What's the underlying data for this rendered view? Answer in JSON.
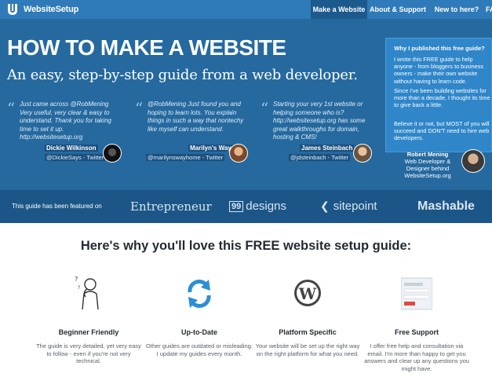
{
  "header": {
    "logo_text": "WebsiteSetup",
    "nav": [
      {
        "label": "Make a Website",
        "active": true
      },
      {
        "label": "About & Support",
        "active": false
      },
      {
        "label": "New to here?",
        "active": false
      },
      {
        "label": "FA",
        "active": false
      }
    ]
  },
  "hero": {
    "title": "HOW TO MAKE A WEBSITE",
    "subtitle": "An easy, step-by-step guide from a web developer.",
    "testimonials": [
      {
        "text": "Just came across @RobMening Very useful, very clear & easy to understand. Thank you for taking time to set it up. http://websitesetup.org",
        "name": "Dickie Wilkinson",
        "handle": "@DickieSays - Twitter"
      },
      {
        "text": "@RobMening Just found you and hoping to learn lots. You explain things in such a way that nontechy like myself can understand.",
        "name": "Marilyn's Way",
        "handle": "@marilynswayhome - Twitter"
      },
      {
        "text": "Starting your very 1st website or helping someone who is? http://websitesetup.org has some great walkthroughs for domain, hosting & CMS!",
        "name": "James Steinbach",
        "handle": "@jdsteinbach - Twitter"
      }
    ],
    "why_box": {
      "title": "Why I published this free guide?",
      "p1": "I wrote this FREE guide to help anyone - from bloggers to business owners - make their own website without having to learn code.",
      "p2": "Since I've been building websites for more than a decade, I thought its time to give back a little.",
      "p3": "Believe it or not, but MOST of you will succeed and DON'T need to hire web developers."
    },
    "author": {
      "name": "Robert Mening",
      "role": "Web Developer &",
      "role2": "Designer behind",
      "site": "WebsiteSetup.org"
    }
  },
  "featured": {
    "label": "This guide has been featured on",
    "publications": [
      "Entrepreneur",
      "99",
      "designs",
      "sitepoint",
      "Mashable"
    ]
  },
  "features_section": {
    "title": "Here's why you'll love this FREE website setup guide:",
    "items": [
      {
        "title": "Beginner Friendly",
        "desc": "The guide is very detailed, yet very easy to follow - even if you're not very technical.",
        "icon": "thinking-person-icon"
      },
      {
        "title": "Up-to-Date",
        "desc": "Other guides are outdated or misleading. I update my guides every month.",
        "icon": "refresh-icon"
      },
      {
        "title": "Platform Specific",
        "desc": "Your website will be set up the right way on the right platform for what you need.",
        "icon": "wordpress-icon"
      },
      {
        "title": "Free Support",
        "desc": "I offer free help and consultation via email. I'm more than happy to get you answers and clear up any questions you might have.",
        "icon": "support-form-icon"
      }
    ]
  },
  "colors": {
    "topbar": "#2f7ab8",
    "hero": "#25699f",
    "featured": "#1c5688",
    "why_box": "#2f86c9"
  }
}
